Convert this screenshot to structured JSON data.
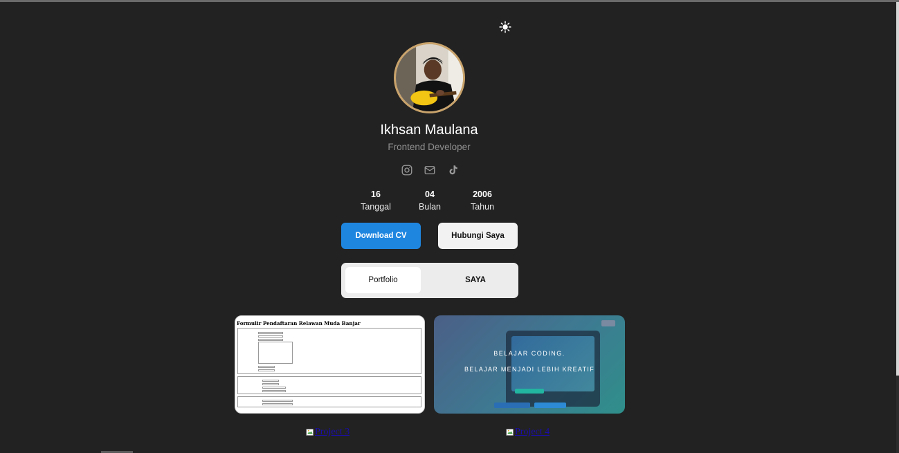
{
  "profile": {
    "name": "Ikhsan Maulana",
    "role": "Frontend Developer"
  },
  "socials": [
    {
      "name": "instagram-icon"
    },
    {
      "name": "mail-icon"
    },
    {
      "name": "tiktok-icon"
    }
  ],
  "birthdate": [
    {
      "value": "16",
      "label": "Tanggal"
    },
    {
      "value": "04",
      "label": "Bulan"
    },
    {
      "value": "2006",
      "label": "Tahun"
    }
  ],
  "actions": {
    "download_label": "Download CV",
    "contact_label": "Hubungi Saya"
  },
  "tabs": [
    {
      "label": "Portfolio",
      "active": true
    },
    {
      "label": "SAYA",
      "active": false
    }
  ],
  "projects": [
    {
      "preview_title": "Formulir Pendaftaran Relawan Muda Banjar",
      "link_text": "Project 3"
    },
    {
      "preview_line1": "BELAJAR CODING.",
      "preview_line2": "BELAJAR MENJADI LEBIH KREATIF",
      "link_text": "Project 4"
    }
  ],
  "colors": {
    "background": "#222222",
    "primary_button": "#1f86e0",
    "avatar_ring": "#c9a36b",
    "link": "#1a0dab"
  },
  "theme_toggle_icon": "sun-icon"
}
